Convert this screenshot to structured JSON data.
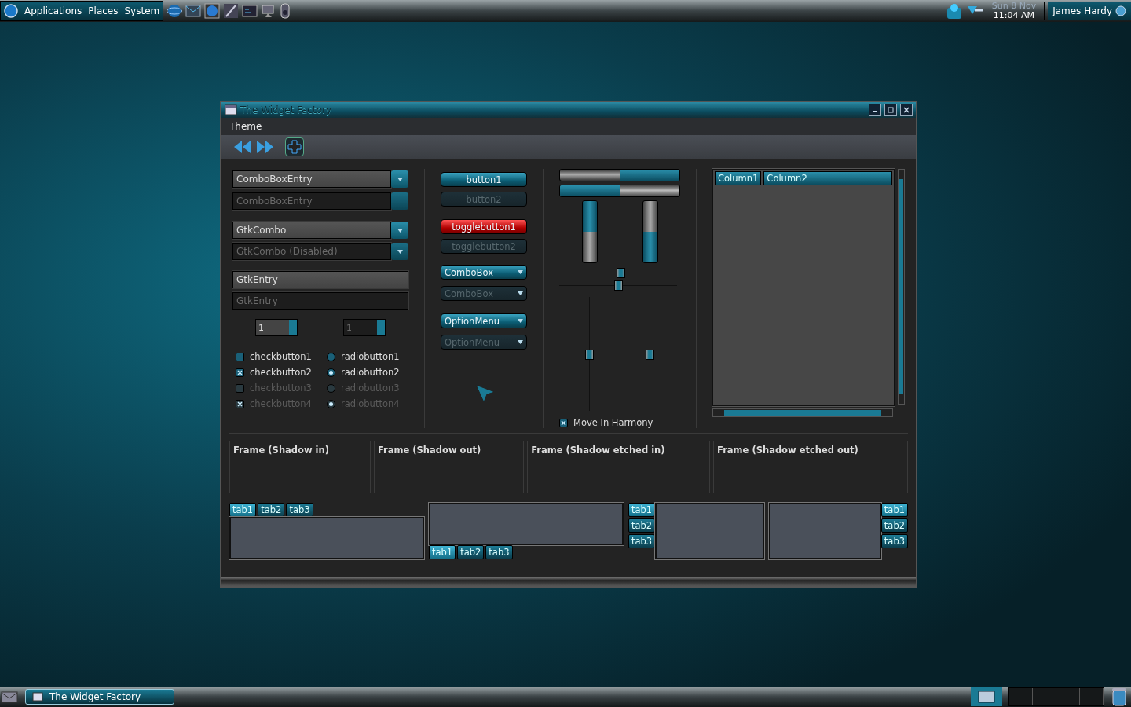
{
  "top_panel": {
    "menus": [
      "Applications",
      "Places",
      "System"
    ],
    "clock": {
      "date": "Sun  8 Nov",
      "time": "11:04 AM"
    },
    "user": "James Hardy"
  },
  "window": {
    "title": "The Widget Factory",
    "menu": [
      "Theme"
    ]
  },
  "combo_entries": [
    {
      "value": "ComboBoxEntry",
      "disabled": false
    },
    {
      "value": "ComboBoxEntry",
      "disabled": true
    }
  ],
  "combos": [
    {
      "value": "GtkCombo",
      "disabled": false
    },
    {
      "value": "GtkCombo (Disabled)",
      "disabled": true
    }
  ],
  "entries": [
    {
      "value": "GtkEntry",
      "disabled": false
    },
    {
      "value": "GtkEntry",
      "disabled": true
    }
  ],
  "spin_buttons": [
    {
      "value": "1",
      "disabled": false
    },
    {
      "value": "1",
      "disabled": true
    }
  ],
  "checkbuttons": [
    {
      "label": "checkbutton1",
      "checked": false,
      "disabled": false
    },
    {
      "label": "checkbutton2",
      "checked": true,
      "disabled": false
    },
    {
      "label": "checkbutton3",
      "checked": false,
      "disabled": true
    },
    {
      "label": "checkbutton4",
      "checked": true,
      "disabled": true
    }
  ],
  "radiobuttons": [
    {
      "label": "radiobutton1",
      "selected": false,
      "disabled": false
    },
    {
      "label": "radiobutton2",
      "selected": true,
      "disabled": false
    },
    {
      "label": "radiobutton3",
      "selected": false,
      "disabled": true
    },
    {
      "label": "radiobutton4",
      "selected": true,
      "disabled": true
    }
  ],
  "buttons": [
    {
      "label": "button1",
      "disabled": false
    },
    {
      "label": "button2",
      "disabled": true
    }
  ],
  "toggle_buttons": [
    {
      "label": "togglebutton1",
      "on": true,
      "disabled": false
    },
    {
      "label": "togglebutton2",
      "on": false,
      "disabled": true
    }
  ],
  "combo_boxes": [
    {
      "value": "ComboBox",
      "disabled": false
    },
    {
      "value": "ComboBox",
      "disabled": true
    }
  ],
  "option_menus": [
    {
      "value": "OptionMenu",
      "disabled": false
    },
    {
      "value": "OptionMenu",
      "disabled": true
    }
  ],
  "horizontal_progress_bars": [
    {
      "inverted": true,
      "level": 0.5
    },
    {
      "inverted": false,
      "level": 0.5
    }
  ],
  "vertical_progress_bars": [
    {
      "inverted": true,
      "level": 0.5
    },
    {
      "inverted": false,
      "level": 0.5
    }
  ],
  "horizontal_scales": [
    {
      "level": 0.52
    },
    {
      "level": 0.5
    }
  ],
  "vertical_scales": [
    {
      "level": 0.5
    },
    {
      "level": 0.5
    }
  ],
  "harmony": {
    "label": "Move In Harmony",
    "checked": true
  },
  "tree": {
    "columns": [
      "Column1",
      "Column2"
    ]
  },
  "frames": [
    "Frame (Shadow in)",
    "Frame (Shadow out)",
    "Frame (Shadow etched in)",
    "Frame (Shadow etched out)"
  ],
  "notebooks": [
    {
      "kind": "top",
      "tabs": [
        {
          "label": "tab1",
          "selected": true
        },
        {
          "label": "tab2",
          "selected": false
        },
        {
          "label": "tab3",
          "selected": false
        }
      ]
    },
    {
      "kind": "bottom",
      "tabs": [
        {
          "label": "tab1",
          "selected": true
        },
        {
          "label": "tab2",
          "selected": false
        },
        {
          "label": "tab3",
          "selected": false
        }
      ]
    },
    {
      "kind": "left",
      "tabs": [
        {
          "label": "tab1",
          "selected": true
        },
        {
          "label": "tab2",
          "selected": false
        },
        {
          "label": "tab3",
          "selected": false
        }
      ]
    },
    {
      "kind": "right",
      "tabs": [
        {
          "label": "tab1",
          "selected": true
        },
        {
          "label": "tab2",
          "selected": false
        },
        {
          "label": "tab3",
          "selected": false
        }
      ]
    }
  ],
  "taskbar": {
    "tasks": [
      {
        "label": "The Widget Factory",
        "selected": true
      }
    ]
  }
}
